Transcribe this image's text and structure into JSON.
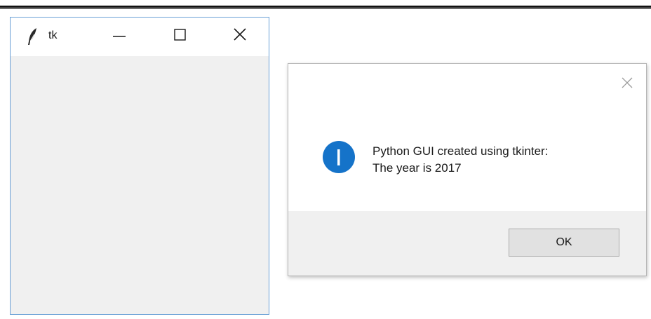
{
  "tk_window": {
    "title": "tk",
    "icons": {
      "app": "feather-icon",
      "minimize": "minimize-icon",
      "maximize": "maximize-icon",
      "close": "close-icon"
    }
  },
  "messagebox": {
    "icon": "info-icon",
    "message_line1": "Python GUI created using tkinter:",
    "message_line2": "The year is 2017",
    "ok_label": "OK",
    "close_icon": "close-icon"
  },
  "colors": {
    "info_blue": "#1573c9",
    "window_border": "#6aa0d6",
    "client_bg": "#f0f0f0"
  }
}
